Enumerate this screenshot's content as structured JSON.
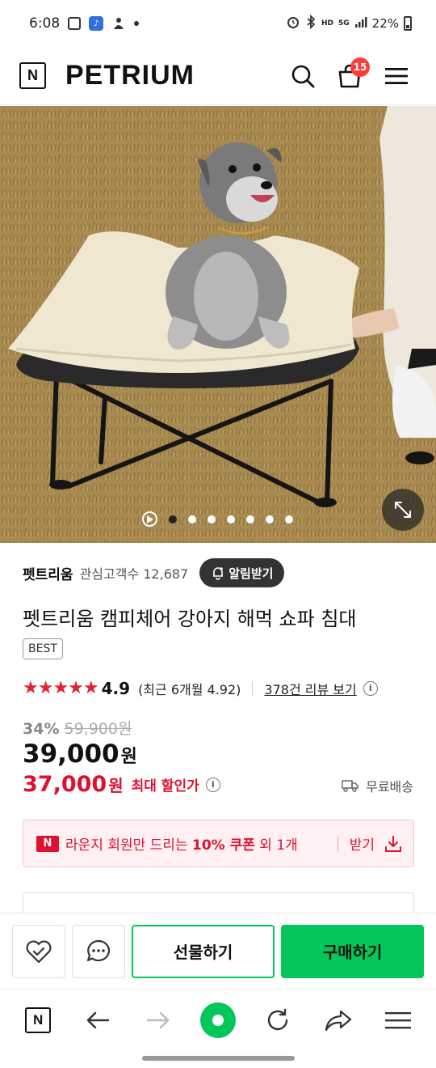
{
  "status_bar": {
    "time": "6:08",
    "battery": "22%",
    "hd_label": "HD",
    "net_label": "5G"
  },
  "header": {
    "n_logo": "N",
    "brand": "PETRIUM",
    "cart_count": "15"
  },
  "hero": {
    "slide_count": 7,
    "active_slide": 1
  },
  "seller": {
    "name": "펫트리움",
    "follow_label": "관심고객수 12,687",
    "notify_label": "알림받기"
  },
  "product": {
    "title": "펫트리움 캠피체어 강아지 해먹 쇼파 침대",
    "badge": "BEST",
    "stars": "★★★★★",
    "rating": "4.9",
    "recent_rating": "(최근 6개월 4.92)",
    "review_link": "378건 리뷰 보기",
    "discount_rate": "34%",
    "original_price": "59,900원",
    "sale_price": "39,000",
    "sale_unit": "원",
    "max_price": "37,000",
    "max_unit": "원",
    "max_label": "최대 할인가",
    "shipping": "무료배송"
  },
  "coupon": {
    "badge": "N",
    "text_pre": "라운지 회원만 드리는 ",
    "text_bold": "10% 쿠폰",
    "text_post": " 외 1개",
    "action": "받기"
  },
  "actions": {
    "gift": "선물하기",
    "buy": "구매하기"
  },
  "browser": {
    "n_logo": "N"
  },
  "colors": {
    "brand_green": "#03c75a",
    "sale_red": "#e0102f",
    "star_red": "#e0262e"
  }
}
